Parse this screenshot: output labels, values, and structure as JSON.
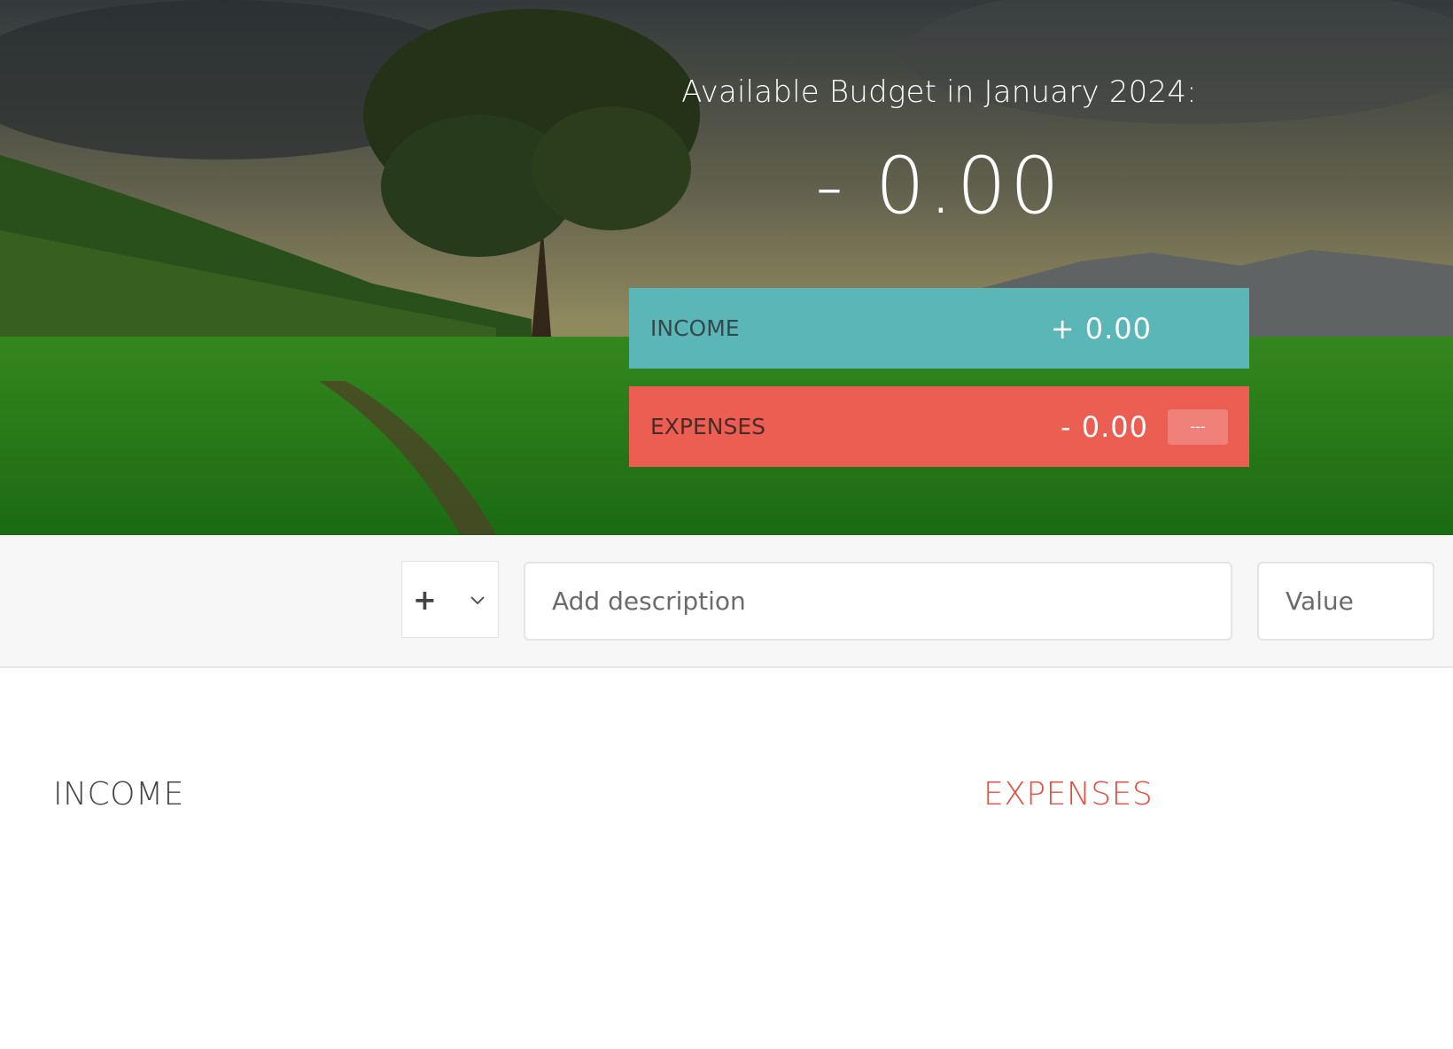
{
  "header": {
    "title": "Available Budget in January 2024:",
    "budget": "- 0.00"
  },
  "summary": {
    "income": {
      "label": "INCOME",
      "value": "+ 0.00"
    },
    "expenses": {
      "label": "EXPENSES",
      "value": "- 0.00",
      "percentage": "---"
    }
  },
  "add": {
    "type_selected": "+",
    "description_placeholder": "Add description",
    "value_placeholder": "Value"
  },
  "lists": {
    "income_title": "INCOME",
    "expenses_title": "EXPENSES"
  },
  "colors": {
    "income": "#5bb6b7",
    "expenses": "#ec5e52",
    "expenses_title": "#e84f3f"
  }
}
